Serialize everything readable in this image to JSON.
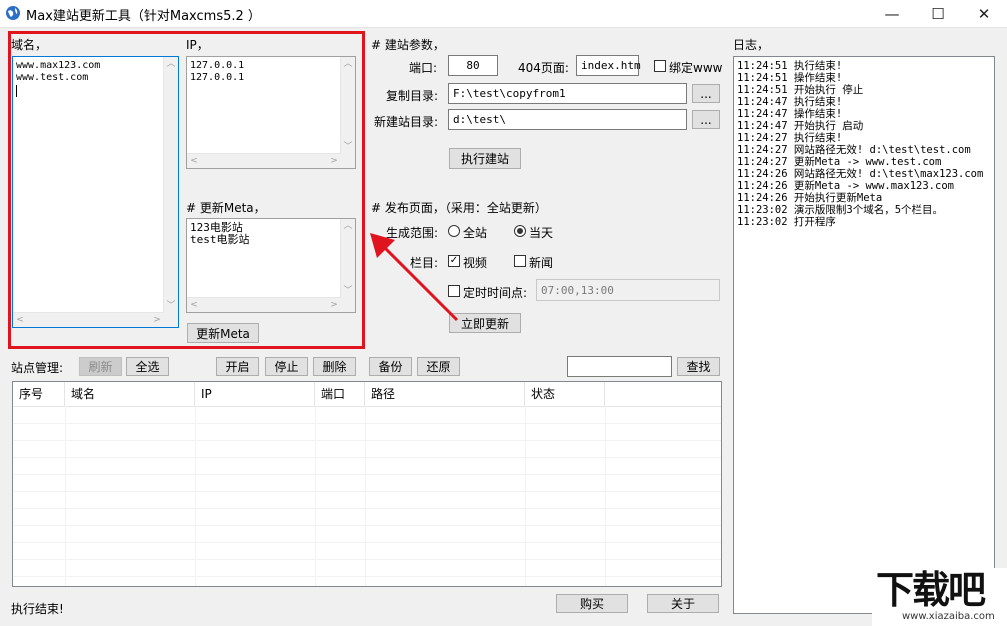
{
  "window": {
    "title": "Max建站更新工具（针对Maxcms5.2 ）",
    "min_glyph": "—",
    "max_glyph": "☐",
    "close_glyph": "✕"
  },
  "left_panel": {
    "domain_label": "域名，",
    "domain_text": "www.max123.com\nwww.test.com",
    "ip_label": "IP，",
    "ip_text": "127.0.0.1\n127.0.0.1",
    "meta_label": "# 更新Meta，",
    "meta_text": "123电影站\ntest电影站",
    "update_meta_button": "更新Meta"
  },
  "build_params": {
    "header": "# 建站参数，",
    "port_label": "端口:",
    "port_value": "80",
    "page404_label": "404页面:",
    "page404_value": "index.htm",
    "bind_www_label": "绑定www",
    "bind_www_checked": false,
    "copy_dir_label": "复制目录:",
    "copy_dir_value": "F:\\test\\copyfrom1",
    "new_dir_label": "新建站目录:",
    "new_dir_value": "d:\\test\\",
    "browse_label": "...",
    "execute_button": "执行建站"
  },
  "publish": {
    "header": "# 发布页面，（采用：全站更新）",
    "range_label": "生成范围:",
    "range_options": [
      "全站",
      "当天"
    ],
    "range_selected": "当天",
    "column_label": "栏目:",
    "column_video": "视频",
    "column_video_checked": true,
    "column_news": "新闻",
    "column_news_checked": false,
    "timed_label": "定时时间点:",
    "timed_checked": false,
    "timed_value": "07:00,13:00",
    "update_now_button": "立即更新"
  },
  "site_mgmt": {
    "label": "站点管理:",
    "buttons": {
      "refresh": "刷新",
      "select_all": "全选",
      "start": "开启",
      "stop": "停止",
      "delete": "删除",
      "backup": "备份",
      "restore": "还原",
      "search": "查找"
    },
    "search_value": "",
    "columns": [
      "序号",
      "域名",
      "IP",
      "端口",
      "路径",
      "状态"
    ]
  },
  "log": {
    "label": "日志，",
    "lines": [
      "11:24:51 执行结束!",
      "11:24:51 操作结束!",
      "11:24:51 开始执行 停止",
      "11:24:47 执行结束!",
      "11:24:47 操作结束!",
      "11:24:47 开始执行 启动",
      "11:24:27 执行结束!",
      "11:24:27 网站路径无效! d:\\test\\test.com",
      "11:24:27 更新Meta -> www.test.com",
      "11:24:26 网站路径无效! d:\\test\\max123.com",
      "11:24:26 更新Meta -> www.max123.com",
      "11:24:26 开始执行更新Meta",
      "11:23:02 演示版限制3个域名，5个栏目。",
      "11:23:02 打开程序"
    ]
  },
  "status_bar": {
    "text": "执行结束!",
    "buy_button": "购买",
    "about_button": "关于"
  },
  "watermark": {
    "text": "下载吧",
    "url": "www.xiazaiba.com"
  },
  "colors": {
    "highlight_red": "#e0141e",
    "focus_blue": "#0078d7"
  }
}
